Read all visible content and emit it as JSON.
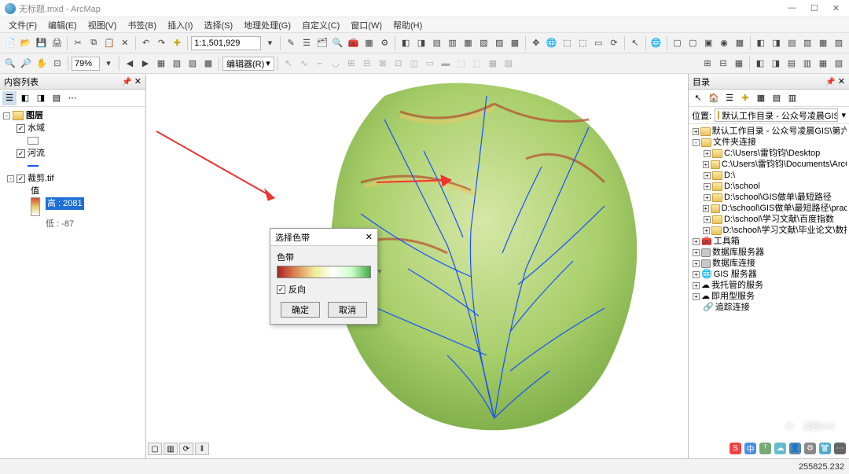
{
  "window": {
    "title": "无标题.mxd - ArcMap",
    "min": "—",
    "max": "☐",
    "close": "✕"
  },
  "menu": [
    "文件(F)",
    "编辑(E)",
    "视图(V)",
    "书签(B)",
    "插入(I)",
    "选择(S)",
    "地理处理(G)",
    "自定义(C)",
    "窗口(W)",
    "帮助(H)"
  ],
  "toolbar1": {
    "scale": "1:1,501,929",
    "pct": "79%"
  },
  "toolbar2": {
    "editor": "编辑器(R)"
  },
  "toc": {
    "title": "内容列表",
    "root": "图层",
    "layers": [
      "水域",
      "河流",
      "裁剪.tif"
    ],
    "raster_value_label": "值",
    "raster_high": "高 : 2081",
    "raster_low": "低 : -87"
  },
  "dialog": {
    "title": "选择色带",
    "ramp_label": "色带",
    "reverse": "反向",
    "ok": "确定",
    "cancel": "取消"
  },
  "catalog": {
    "title": "目录",
    "location_label": "位置:",
    "location_value": "默认工作目录 - 公众号凌晨GIS\\第六",
    "nodes": [
      {
        "d": 0,
        "exp": "+",
        "icon": "home",
        "label": "默认工作目录 - 公众号凌晨GIS\\第六期"
      },
      {
        "d": 0,
        "exp": "-",
        "icon": "folder",
        "label": "文件夹连接"
      },
      {
        "d": 1,
        "exp": "+",
        "icon": "folder",
        "label": "C:\\Users\\雷钧钧\\Desktop"
      },
      {
        "d": 1,
        "exp": "+",
        "icon": "folder",
        "label": "C:\\Users\\雷钧钧\\Documents\\ArcGIS"
      },
      {
        "d": 1,
        "exp": "+",
        "icon": "folder",
        "label": "D:\\"
      },
      {
        "d": 1,
        "exp": "+",
        "icon": "folder",
        "label": "D:\\school"
      },
      {
        "d": 1,
        "exp": "+",
        "icon": "folder",
        "label": "D:\\school\\GIS做单\\最短路径"
      },
      {
        "d": 1,
        "exp": "+",
        "icon": "folder",
        "label": "D:\\school\\GIS做单\\最短路径\\practice"
      },
      {
        "d": 1,
        "exp": "+",
        "icon": "folder",
        "label": "D:\\school\\学习文献\\百度指数"
      },
      {
        "d": 1,
        "exp": "+",
        "icon": "folder",
        "label": "D:\\school\\学习文献\\毕业论文\\数据"
      },
      {
        "d": 0,
        "exp": "+",
        "icon": "tool",
        "label": "工具箱"
      },
      {
        "d": 0,
        "exp": "+",
        "icon": "db",
        "label": "数据库服务器"
      },
      {
        "d": 0,
        "exp": "+",
        "icon": "db",
        "label": "数据库连接"
      },
      {
        "d": 0,
        "exp": "+",
        "icon": "globe",
        "label": "GIS 服务器"
      },
      {
        "d": 0,
        "exp": "+",
        "icon": "cloud",
        "label": "我托管的服务"
      },
      {
        "d": 0,
        "exp": "+",
        "icon": "cloud",
        "label": "即用型服务"
      },
      {
        "d": 0,
        "exp": "",
        "icon": "link",
        "label": "追踪连接"
      }
    ]
  },
  "watermark": "凌晨GIS",
  "statusbar": {
    "coords": "255825.232"
  },
  "tray_labels": [
    "S",
    "中",
    "ᵀ",
    "☁",
    "👤",
    "⚙",
    "👕",
    "⋯"
  ]
}
